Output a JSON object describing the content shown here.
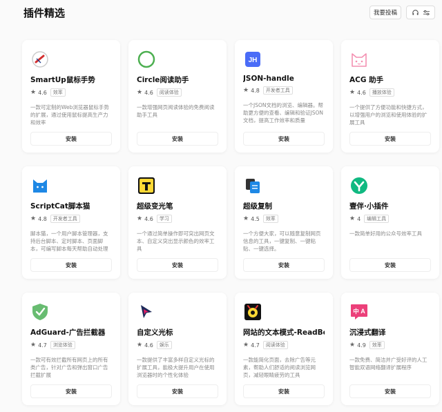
{
  "page": {
    "title": "插件精选"
  },
  "header": {
    "submit_label": "我要投稿",
    "headset_icon": "headset-icon",
    "filter_icon": "sliders-icon"
  },
  "colors": {
    "accent_green": "#10b981",
    "circle_green": "#4caf50",
    "json_blue": "#4a6cf7",
    "acg_pink": "#f48fb1"
  },
  "plugins": [
    {
      "name": "SmartUp鼠标手势",
      "rating": "4.6",
      "tag": "效率",
      "desc": "一款可定制的Web浏览器鼠标手势的扩展，通过使用鼠标提高生产力和效率",
      "install": "安装",
      "icon": "mouse-gesture-icon"
    },
    {
      "name": "Circle阅读助手",
      "rating": "4.6",
      "tag": "阅读体验",
      "desc": "一款增强网页阅读体验的免费阅读助手工具",
      "install": "安装",
      "icon": "circle-icon"
    },
    {
      "name": "JSON-handle",
      "rating": "4.8",
      "tag": "开发者工具",
      "desc": "一个JSON文档的浏览、编辑器。帮助更方便的查看、编辑和验证JSON文档，提高工作效率和质量",
      "install": "安装",
      "icon": "jh-icon"
    },
    {
      "name": "ACG 助手",
      "rating": "4.6",
      "tag": "播放体验",
      "desc": "一个提供了方便功能和快捷方式，以增强用户的浏览和使用体验的扩展工具",
      "install": "安装",
      "icon": "cat-face-icon"
    },
    {
      "name": "ScriptCat脚本猫",
      "rating": "4.8",
      "tag": "开发者工具",
      "desc": "脚本猫，一个用户脚本管理器，支持后台脚本、定时脚本、页面脚本，可编写脚本每天帮助自动处理事务",
      "install": "安装",
      "icon": "scriptcat-icon"
    },
    {
      "name": "超级变光笔",
      "rating": "4.6",
      "tag": "学习",
      "desc": "一个通过简单操作即可突出网页文本、自定义突出显示颜色的效率工具",
      "install": "安装",
      "icon": "highlighter-icon"
    },
    {
      "name": "超级复制",
      "rating": "4.5",
      "tag": "效率",
      "desc": "一个方便大家，可以随意复制网页信息的工具，一键复制、一键粘贴、一键选择。",
      "install": "安装",
      "icon": "copy-icon"
    },
    {
      "name": "壹伴·小插件",
      "rating": "4",
      "tag": "编辑工具",
      "desc": "一款简单好用的公众号效率工具",
      "install": "安装",
      "icon": "yiban-icon"
    },
    {
      "name": "AdGuard-广告拦截器",
      "rating": "4.7",
      "tag": "浏览体验",
      "desc": "一款可有效拦截所有网页上的所有类广告，针对广告和弹出窗口广告拦截扩展",
      "install": "安装",
      "icon": "shield-check-icon"
    },
    {
      "name": "自定义光标",
      "rating": "4.6",
      "tag": "娱乐",
      "desc": "一款提供了丰富多样自定义光标的扩展工具，能极大提升用户在使用浏览器时的个性化体验",
      "install": "安装",
      "icon": "cursor-icon"
    },
    {
      "name": "网站的文本模式-ReadBee",
      "rating": "4.7",
      "tag": "阅读体验",
      "desc": "一款能简化页面，去除广告等元素，帮助人们舒适的阅读浏览网页，减轻眼睛疲劳的工具",
      "install": "安装",
      "icon": "readbee-icon"
    },
    {
      "name": "沉浸式翻译",
      "rating": "4.9",
      "tag": "效率",
      "desc": "一款免费、简洁并广受好评的人工智能双语网络翻译扩展程序",
      "install": "安装",
      "icon": "translate-icon"
    }
  ]
}
